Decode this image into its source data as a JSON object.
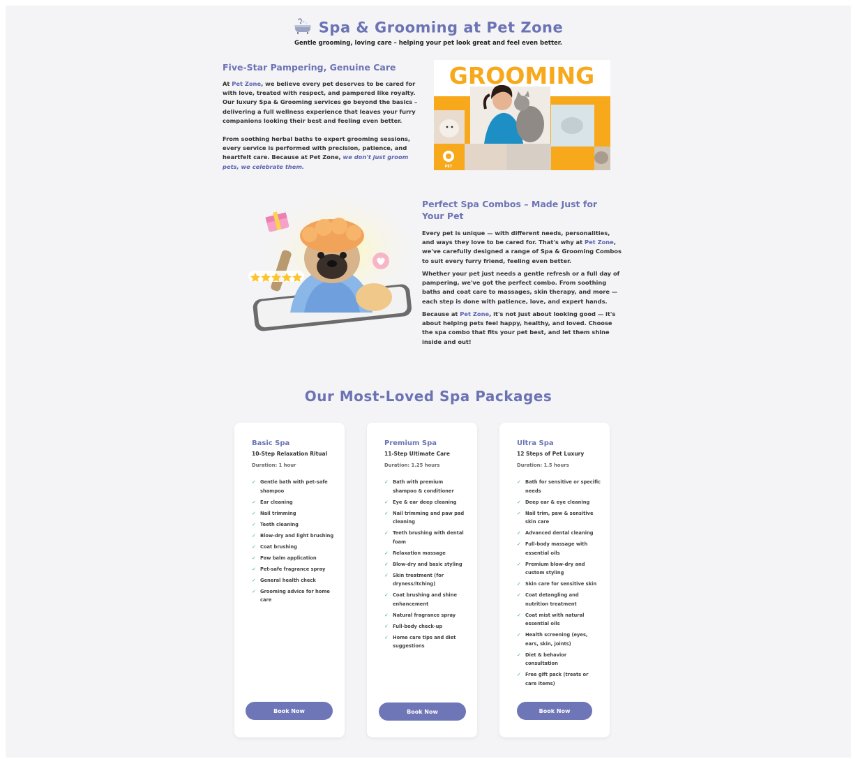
{
  "hero": {
    "title": "Spa & Grooming at Pet Zone",
    "subtitle": "Gentle grooming, loving care – helping your pet look great and feel even better."
  },
  "section1": {
    "heading": "Five-Star Pampering, Genuine Care",
    "p1_a": "At ",
    "p1_brand": "Pet Zone",
    "p1_b": ", we believe every pet deserves to be cared for with love, treated with respect, and pampered like royalty. Our luxury Spa & Grooming services go beyond the basics – delivering a full wellness experience that leaves your furry companions looking their best and feeling even better.",
    "p2_a": "From soothing herbal baths to expert grooming sessions, every service is performed with precision, patience, and heartfelt care. Because at Pet Zone, ",
    "p2_em": "we don't just groom pets, we celebrate them.",
    "image_banner": "GROOMING",
    "image_logo": "PET"
  },
  "section2": {
    "heading": "Perfect Spa Combos – Made Just for Your Pet",
    "p1_a": "Every pet is unique — with different needs, personalities, and ways they love to be cared for. That's why at ",
    "p1_brand": "Pet Zone",
    "p1_b": ", we've carefully designed a range of Spa & Grooming Combos to suit every furry friend, feeling even better.",
    "p2": "Whether your pet just needs a gentle refresh or a full day of pampering, we've got the perfect combo. From soothing baths and coat care to massages, skin therapy, and more — each step is done with patience, love, and expert hands.",
    "p3_a": "Because at ",
    "p3_brand": "Pet Zone",
    "p3_b": ", it's not just about looking good — it's about helping pets feel happy, healthy, and loved. Choose the spa combo that fits your pet best, and let them shine inside and out!"
  },
  "packages": {
    "title": "Our Most-Loved Spa Packages",
    "cards": [
      {
        "name": "Basic Spa",
        "tagline": "10-Step Relaxation Ritual",
        "duration": "Duration: 1 hour",
        "features": [
          "Gentle bath with pet-safe shampoo",
          "Ear cleaning",
          "Nail trimming",
          "Teeth cleaning",
          "Blow-dry and light brushing",
          "Coat brushing",
          "Paw balm application",
          "Pet-safe fragrance spray",
          "General health check",
          "Grooming advice for home care"
        ],
        "button": "Book Now"
      },
      {
        "name": "Premium Spa",
        "tagline": "11-Step Ultimate Care",
        "duration": "Duration: 1.25 hours",
        "features": [
          "Bath with premium shampoo & conditioner",
          "Eye & ear deep cleaning",
          "Nail trimming and paw pad cleaning",
          "Teeth brushing with dental foam",
          "Relaxation massage",
          "Blow-dry and basic styling",
          "Skin treatment (for dryness/itching)",
          "Coat brushing and shine enhancement",
          "Natural fragrance spray",
          "Full-body check-up",
          "Home care tips and diet suggestions"
        ],
        "button": "Book Now"
      },
      {
        "name": "Ultra Spa",
        "tagline": "12 Steps of Pet Luxury",
        "duration": "Duration: 1.5 hours",
        "features": [
          "Bath for sensitive or specific needs",
          "Deep ear & eye cleaning",
          "Nail trim, paw & sensitive skin care",
          "Advanced dental cleaning",
          "Full-body massage with essential oils",
          "Premium blow-dry and custom styling",
          "Skin care for sensitive skin",
          "Coat detangling and nutrition treatment",
          "Coat mist with natural essential oils",
          "Health screening (eyes, ears, skin, joints)",
          "Diet & behavior consultation",
          "Free gift pack (treats or care items)"
        ],
        "button": "Book Now"
      }
    ]
  },
  "icons": {
    "hero": "bathtub-icon",
    "check": "check-icon",
    "check_glyph": "✓"
  },
  "colors": {
    "accent": "#6c73b4",
    "button": "#6f76b8",
    "check": "#3eae6a",
    "grooming_orange": "#f7a81b",
    "grooming_blue": "#1e8fc4"
  }
}
